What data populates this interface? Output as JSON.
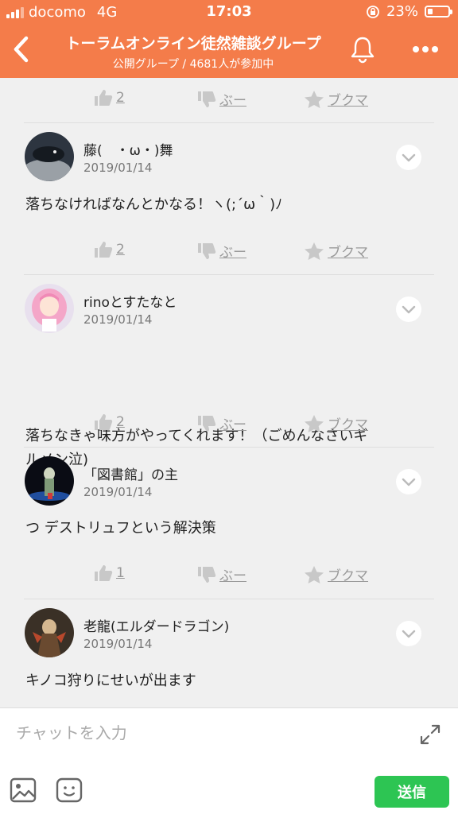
{
  "status_bar": {
    "carrier": "docomo",
    "network": "4G",
    "time": "17:03",
    "battery": "23%",
    "battery_level": 0.23
  },
  "header": {
    "title": "トーラムオンライン徒然雑談グループ",
    "subtitle": "公開グループ / 4681人が参加中",
    "bg_color": "#f47c4a"
  },
  "actions_top": {
    "like_count": "2",
    "boo_label": "ぶー",
    "fav_label": "ブクマ"
  },
  "posts": [
    {
      "user": "藤(　・ω・)舞",
      "date": "2019/01/14",
      "message_lines": [
        "落ちなければなんとかなる！ヽ(;´ω｀)ﾉ"
      ],
      "like_count": "2",
      "boo_label": "ぶー",
      "fav_label": "ブクマ"
    },
    {
      "user": "rinoとすたなと",
      "date": "2019/01/14",
      "message_lines": [
        "落ちなきゃ味方がやってくれます！（ごめんなさいギ",
        "ルメン泣)"
      ],
      "like_count": "2",
      "boo_label": "ぶー",
      "fav_label": "ブクマ"
    },
    {
      "user": "「図書館」の主",
      "date": "2019/01/14",
      "message_lines": [
        "つ デストリュフという解決策"
      ],
      "like_count": "1",
      "boo_label": "ぶー",
      "fav_label": "ブクマ"
    },
    {
      "user": "老龍(エルダードラゴン)",
      "date": "2019/01/14",
      "message_lines": [
        "キノコ狩りにせいが出ます"
      ]
    }
  ],
  "composer": {
    "placeholder": "チャットを入力",
    "send_label": "送信",
    "send_color": "#2dc553"
  }
}
